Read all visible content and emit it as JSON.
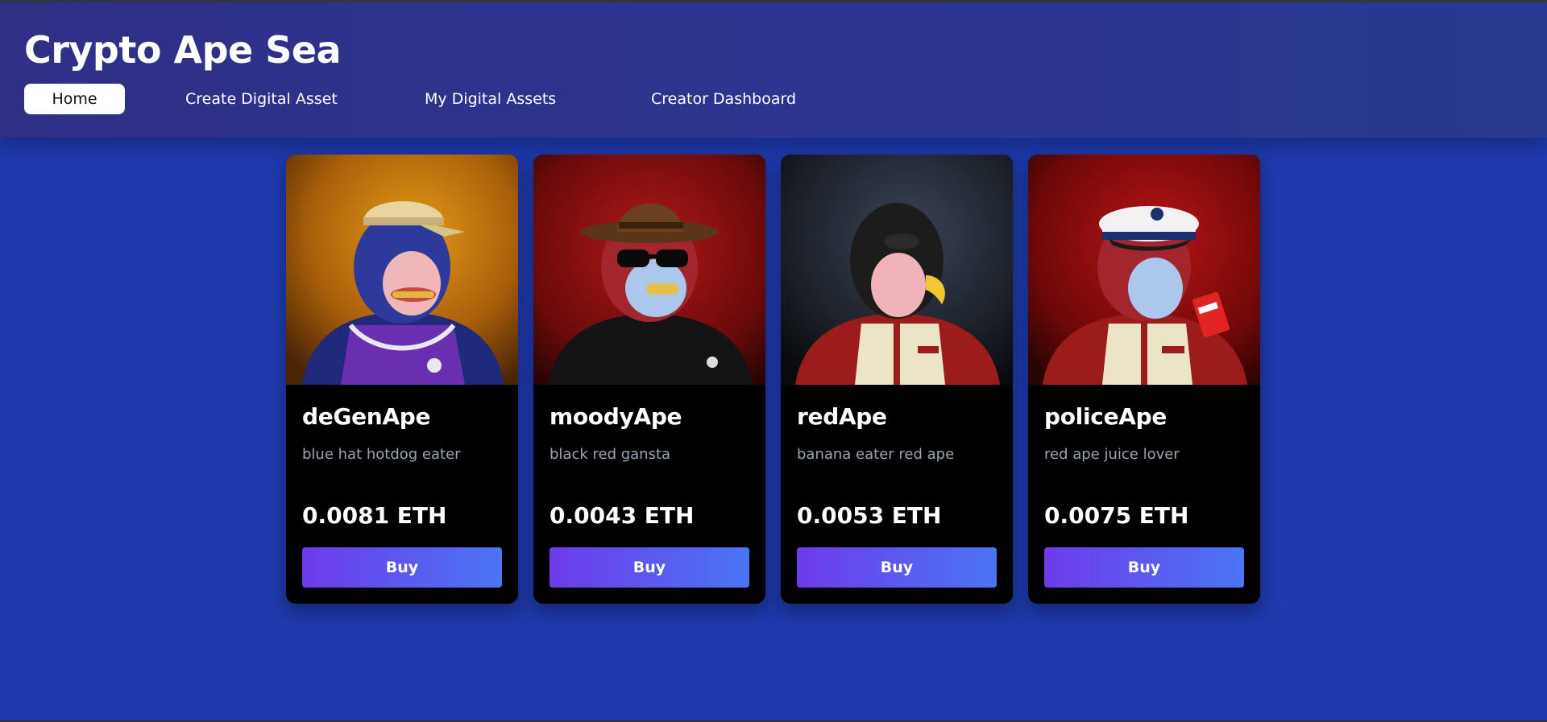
{
  "app": {
    "title": "Crypto Ape Sea"
  },
  "nav": {
    "items": [
      {
        "label": "Home",
        "active": true
      },
      {
        "label": "Create Digital Asset",
        "active": false
      },
      {
        "label": "My Digital Assets",
        "active": false
      },
      {
        "label": "Creator Dashboard",
        "active": false
      }
    ]
  },
  "listings": [
    {
      "name": "deGenApe",
      "description": "blue hat hotdog eater",
      "price": "0.0081 ETH",
      "buy_label": "Buy"
    },
    {
      "name": "moodyApe",
      "description": "black red gansta",
      "price": "0.0043 ETH",
      "buy_label": "Buy"
    },
    {
      "name": "redApe",
      "description": "banana eater red ape",
      "price": "0.0053 ETH",
      "buy_label": "Buy"
    },
    {
      "name": "policeApe",
      "description": "red ape juice lover",
      "price": "0.0075 ETH",
      "buy_label": "Buy"
    }
  ],
  "colors": {
    "page_background": "#1e3aad",
    "header_background": "#2c3590",
    "card_background": "#000000",
    "button_gradient_start": "#6e3bea",
    "button_gradient_end": "#4a76f4"
  }
}
